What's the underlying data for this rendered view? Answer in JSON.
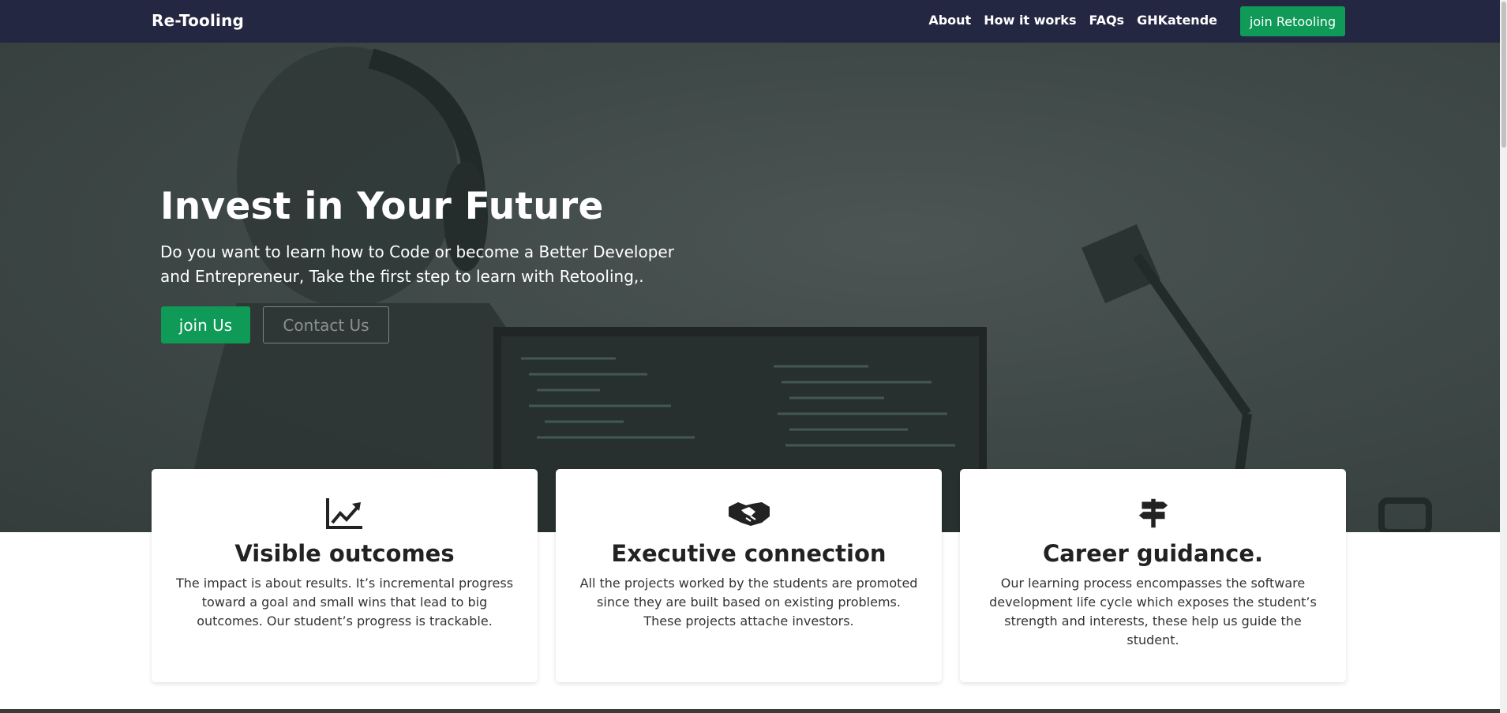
{
  "navbar": {
    "brand": "Re-Tooling",
    "links": [
      "About",
      "How it works",
      "FAQs",
      "GHKatende"
    ],
    "cta_label": "join Retooling"
  },
  "hero": {
    "title": "Invest in Your Future",
    "subtitle": "Do you want to learn how to Code or become a Better Developer and Entrepreneur, Take the first step to learn with Retooling,.",
    "primary_button": "join Us",
    "secondary_button": "Contact Us"
  },
  "features": [
    {
      "icon": "chart-line-icon",
      "title": "Visible outcomes",
      "text": "The impact is about results. It’s incremental progress toward a goal and small wins that lead to big outcomes. Our student’s progress is trackable."
    },
    {
      "icon": "handshake-icon",
      "title": "Executive connection",
      "text": "All the projects worked by the students are promoted since they are built based on existing problems. These projects attache investors."
    },
    {
      "icon": "signpost-icon",
      "title": "Career guidance.",
      "text": "Our learning process encompasses the software development life cycle which exposes the student’s strength and interests, these help us guide the student."
    }
  ],
  "colors": {
    "navbar_bg": "#232742",
    "accent_green": "#0f9a58",
    "hero_overlay": "#3f4947"
  }
}
